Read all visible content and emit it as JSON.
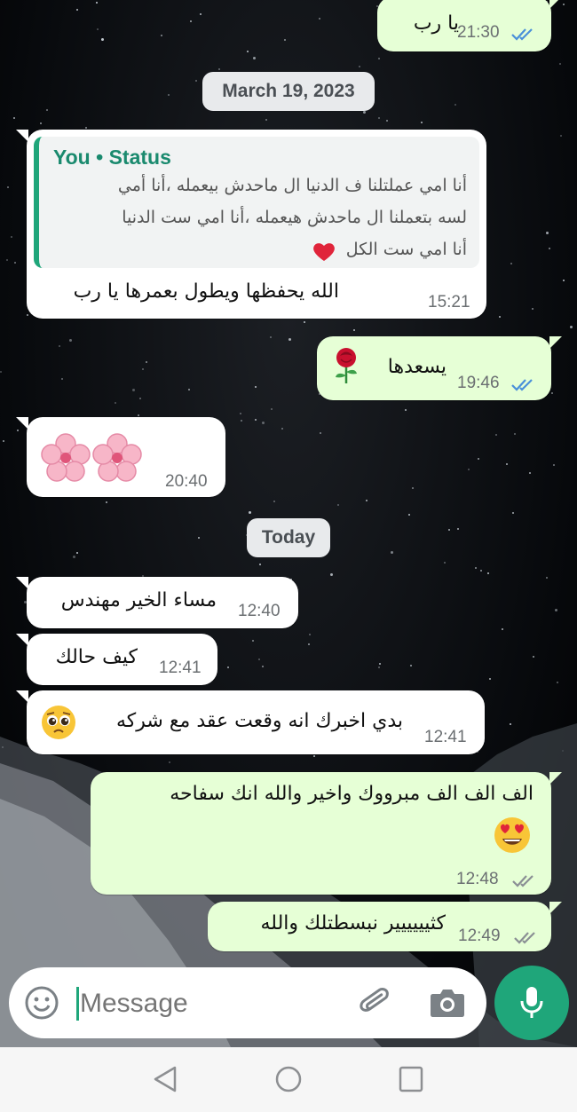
{
  "colors": {
    "incoming_bubble": "#ffffff",
    "outgoing_bubble": "#e6ffd6",
    "read_ticks": "#4a90d9",
    "delivered_ticks": "#8a8f94",
    "accent": "#1fa67a",
    "quote_author": "#1a8a6e"
  },
  "messages": [
    {
      "text": "يا رب",
      "time": "21:30",
      "status": "read"
    },
    {
      "quote_author": "You • Status",
      "quote_line1": "أنا امي عملتلنا ف الدنيا ال ماحدش بيعمله ،أنا أمي",
      "quote_line2": "لسه بتعملنا ال ماحدش هيعمله ،أنا امي ست الدنيا",
      "quote_line3": "أنا امي ست الكل",
      "text": "الله يحفظها ويطول بعمرها يا رب",
      "time": "15:21"
    },
    {
      "text": "يسعدها",
      "time": "19:46",
      "status": "read"
    },
    {
      "time": "20:40"
    },
    {
      "text": "مساء الخير مهندس",
      "time": "12:40"
    },
    {
      "text": "كيف حالك",
      "time": "12:41"
    },
    {
      "text": "بدي اخبرك انه وقعت عقد مع شركه",
      "time": "12:41"
    },
    {
      "text": "الف الف الف مبرووك واخير والله انك سفاحه",
      "time": "12:48",
      "status": "delivered"
    },
    {
      "text": "كثيييييير نبسطتلك والله",
      "time": "12:49",
      "status": "delivered"
    }
  ],
  "date_separators": [
    "March 19, 2023",
    "Today"
  ],
  "composer": {
    "placeholder": "Message",
    "emoji_icon": "smiley-icon",
    "attach_icon": "paperclip-icon",
    "camera_icon": "camera-icon",
    "mic_icon": "microphone-icon"
  },
  "navigation": {
    "back": "back-triangle-icon",
    "home": "home-circle-icon",
    "recents": "recents-square-icon"
  }
}
